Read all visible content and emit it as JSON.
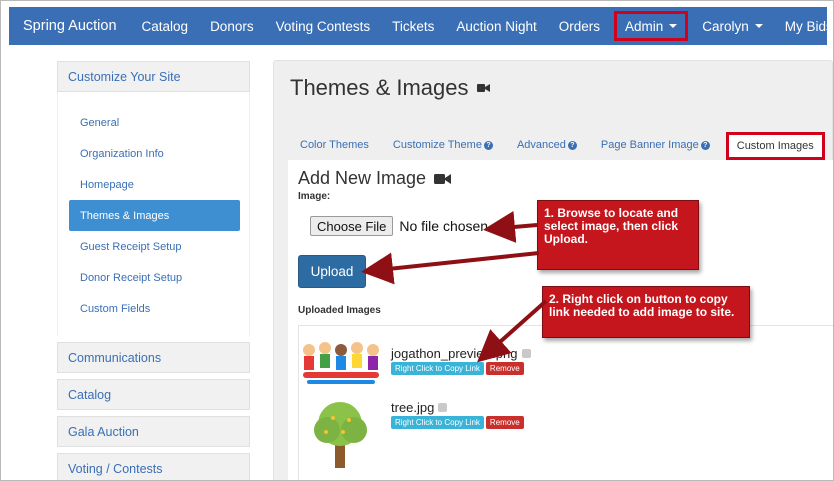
{
  "navbar": {
    "brand": "Spring Auction",
    "items": [
      "Catalog",
      "Donors",
      "Voting Contests",
      "Tickets",
      "Auction Night",
      "Orders"
    ],
    "admin": "Admin",
    "user": "Carolyn",
    "my_bids": "My Bids"
  },
  "sidebar": {
    "header": "Customize Your Site",
    "links": [
      "General",
      "Organization Info",
      "Homepage",
      "Themes & Images",
      "Guest Receipt Setup",
      "Donor Receipt Setup",
      "Custom Fields"
    ],
    "active_index": 3,
    "sections": [
      "Communications",
      "Catalog",
      "Gala Auction",
      "Voting / Contests"
    ]
  },
  "main": {
    "title": "Themes & Images",
    "tabs": [
      "Color Themes",
      "Customize Theme",
      "Advanced",
      "Page Banner Image",
      "Custom Images"
    ],
    "active_tab": "Custom Images",
    "add_title": "Add New Image",
    "image_label": "Image:",
    "choose_file": "Choose File",
    "no_file": "No file chosen",
    "upload": "Upload",
    "uploaded_label": "Uploaded Images",
    "images": [
      {
        "name": "jogathon_preview.png",
        "copy": "Right Click to Copy Link",
        "remove": "Remove"
      },
      {
        "name": "tree.jpg",
        "copy": "Right Click to Copy Link",
        "remove": "Remove"
      }
    ]
  },
  "callouts": {
    "one": "1. Browse to locate and select image, then click Upload.",
    "two": "2. Right click on button to copy link needed to add image to site."
  },
  "colors": {
    "navbar": "#3a6fb5",
    "highlight": "#d0021b",
    "callout": "#c4161c",
    "upload_button": "#2d6ca2",
    "copy_button": "#3ab3d8",
    "remove_button": "#c9302c",
    "active_side": "#3e8ed2"
  },
  "icons": [
    "video-camera-icon",
    "help-icon",
    "caret-down-icon",
    "puzzle-icon"
  ]
}
